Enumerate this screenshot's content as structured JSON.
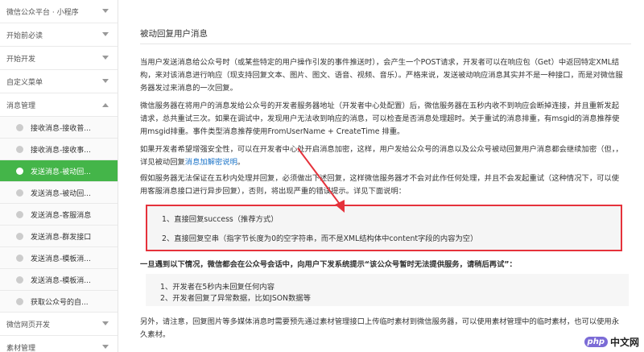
{
  "sidebar": {
    "items": [
      {
        "label": "微信公众平台 · 小程序",
        "type": "top",
        "chevron": true
      },
      {
        "label": "开始前必读",
        "type": "top",
        "chevron": true
      },
      {
        "label": "开始开发",
        "type": "top",
        "chevron": true
      },
      {
        "label": "自定义菜单",
        "type": "top",
        "chevron": true
      },
      {
        "label": "消息管理",
        "type": "top",
        "chevron": true,
        "expanded": true
      },
      {
        "label": "接收消息-接收普...",
        "type": "sub"
      },
      {
        "label": "接收消息-接收事...",
        "type": "sub"
      },
      {
        "label": "发送消息-被动回...",
        "type": "sub",
        "active": true
      },
      {
        "label": "发送消息-被动回...",
        "type": "sub"
      },
      {
        "label": "发送消息-客服消息",
        "type": "sub"
      },
      {
        "label": "发送消息-群发接口",
        "type": "sub"
      },
      {
        "label": "发送消息-模板消...",
        "type": "sub"
      },
      {
        "label": "发送消息-模板消...",
        "type": "sub"
      },
      {
        "label": "获取公众号的自...",
        "type": "sub"
      },
      {
        "label": "微信网页开发",
        "type": "top",
        "chevron": true
      },
      {
        "label": "素材管理",
        "type": "top",
        "chevron": true
      }
    ]
  },
  "main": {
    "title": "被动回复用户消息",
    "p1": "当用户发送消息给公众号时（或某些特定的用户操作引发的事件推送时），会产生一个POST请求，开发者可以在响应包（Get）中返回特定XML结构，来对该消息进行响应（现支持回复文本、图片、图文、语音、视频、音乐）。严格来说，发送被动响应消息其实并不是一种接口，而是对微信服务器发过来消息的一次回复。",
    "p2": "微信服务器在将用户的消息发给公众号的开发者服务器地址（开发者中心处配置）后，微信服务器在五秒内收不到响应会断掉连接，并且重新发起请求，总共重试三次。如果在调试中，发现用户无法收到响应的消息，可以检查是否消息处理超时。关于重试的消息排重，有msgid的消息推荐使用msgid排重。事件类型消息推荐使用FromUserName + CreateTime 排重。",
    "p3_a": "如果开发者希望增强安全性，可以在开发者中心处开启消息加密，这样，用户发给公众号的消息以及公众号被动回复用户消息都会继续加密（但，，详见被动回复",
    "p3_link": "消息加解密说明",
    "p3_b": "。",
    "p4": "假如服务器无法保证在五秒内处理并回复，必须做出下述回复，这样微信服务器才不会对此作任何处理，并且不会发起重试（这种情况下，可以使用客服消息接口进行异步回复），否则，将出现严重的错误提示。详见下面说明：",
    "options": [
      "1、直接回复success（推荐方式）",
      "2、直接回复空串（指字节长度为0的空字符串，而不是XML结构体中content字段的内容为空）"
    ],
    "warning": "一旦遇到以下情况，微信都会在公众号会话中，向用户下发系统提示“该公众号暂时无法提供服务，请稍后再试”：",
    "cases": [
      "1、开发者在5秒内未回复任何内容",
      "2、开发者回复了异常数据，比如JSON数据等"
    ],
    "p5": "另外，请注意，回复图片等多媒体消息时需要预先通过素材管理接口上传临时素材到微信服务器，可以使用素材管理中的临时素材，也可以使用永久素材。"
  },
  "watermark": {
    "brand": "php",
    "text": "中文网"
  },
  "colors": {
    "active": "#44b549",
    "highlight_border": "#e5323b",
    "link": "#1a73c8"
  }
}
